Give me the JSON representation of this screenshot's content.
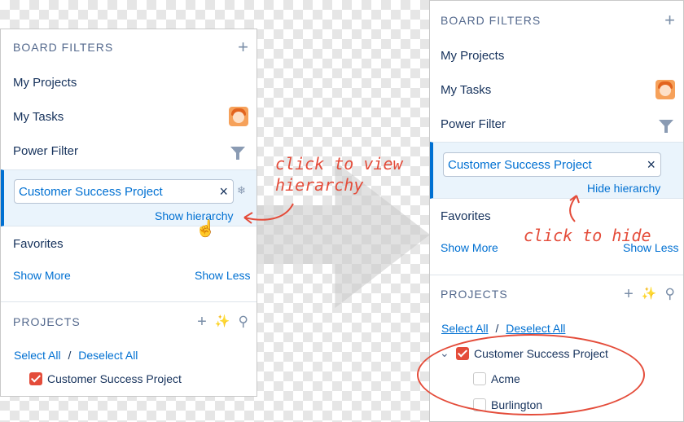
{
  "left_panel": {
    "board_filters_title": "BOARD FILTERS",
    "add_icon": "+",
    "my_projects": "My Projects",
    "my_tasks": "My Tasks",
    "power_filter": "Power Filter",
    "filter_chip": "Customer Success Project",
    "clear_icon": "×",
    "gear_icon": "❄",
    "hierarchy_link": "Show hierarchy",
    "favorites": "Favorites",
    "show_more": "Show More",
    "show_less": "Show Less",
    "projects_title": "PROJECTS",
    "wand_icon": "⁄",
    "search_icon": "⚲",
    "select_all": "Select All",
    "separator": "/",
    "deselect_all": "Deselect All",
    "project_item": "Customer Success Project"
  },
  "right_panel": {
    "board_filters_title": "BOARD FILTERS",
    "add_icon": "+",
    "my_projects": "My Projects",
    "my_tasks": "My Tasks",
    "power_filter": "Power Filter",
    "filter_chip": "Customer Success Project",
    "clear_icon": "×",
    "hierarchy_link": "Hide hierarchy",
    "favorites": "Favorites",
    "show_more": "Show More",
    "show_less": "Show Less",
    "projects_title": "PROJECTS",
    "select_all": "Select All",
    "separator": "/",
    "deselect_all": "Deselect All",
    "chevron_icon": "⌄",
    "project_item": "Customer Success Project",
    "child_items": [
      "Acme",
      "Burlington"
    ]
  },
  "annotations": {
    "click_to_view_line1": "click to view",
    "click_to_view_line2": "hierarchy",
    "click_to_hide": "click to hide"
  },
  "colors": {
    "accent": "#0070d2",
    "annotation": "#e44c3a",
    "checkbox_checked": "#e44c3a",
    "highlight_bg": "#eaf4fc"
  }
}
